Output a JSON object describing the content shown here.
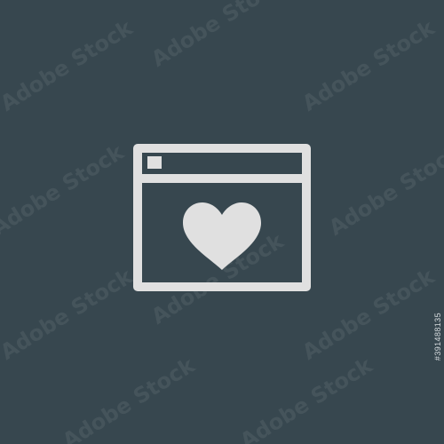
{
  "image": {
    "background_color": "#37474f",
    "icon_color": "#e0e0e0",
    "icon": "browser-window-heart-icon",
    "stock_id": "#391488135",
    "watermark": "Adobe Stock"
  }
}
